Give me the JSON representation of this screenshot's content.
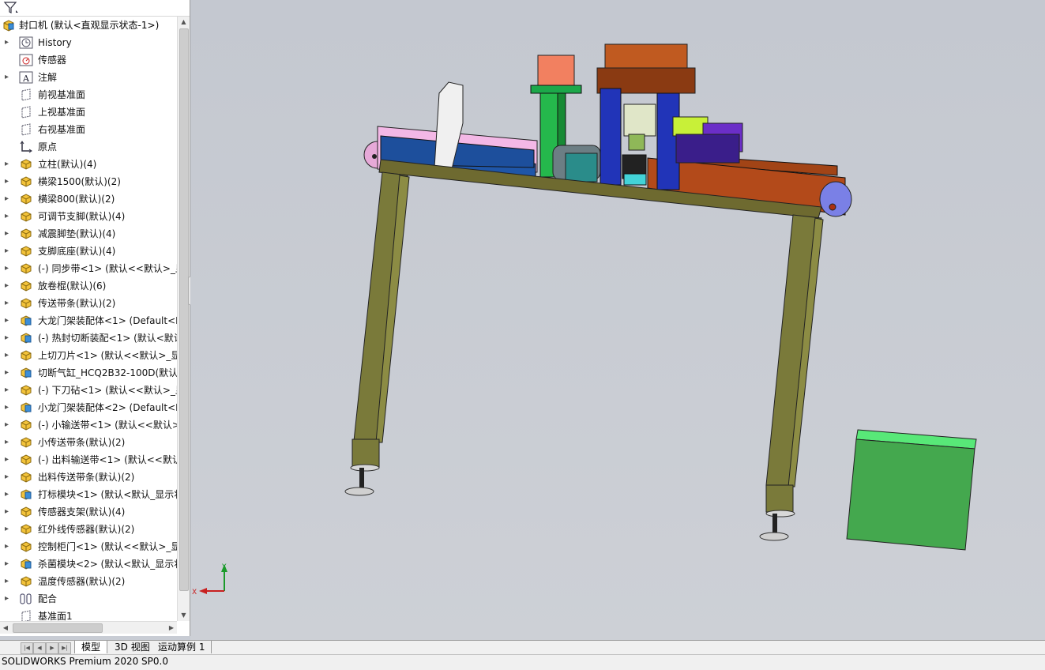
{
  "tree": {
    "root_label": "封口机  (默认<直观显示状态-1>)",
    "items": [
      {
        "label": "History",
        "icon": "history-icon",
        "expandable": true
      },
      {
        "label": "传感器",
        "icon": "sensor-icon",
        "expandable": false
      },
      {
        "label": "注解",
        "icon": "annotation-icon",
        "expandable": true
      },
      {
        "label": "前视基准面",
        "icon": "plane-icon",
        "expandable": false
      },
      {
        "label": "上视基准面",
        "icon": "plane-icon",
        "expandable": false
      },
      {
        "label": "右视基准面",
        "icon": "plane-icon",
        "expandable": false
      },
      {
        "label": "原点",
        "icon": "origin-icon",
        "expandable": false
      },
      {
        "label": "立柱(默认)(4)",
        "icon": "part-icon",
        "expandable": true
      },
      {
        "label": "横梁1500(默认)(2)",
        "icon": "part-icon",
        "expandable": true
      },
      {
        "label": "横梁800(默认)(2)",
        "icon": "part-icon",
        "expandable": true
      },
      {
        "label": "可调节支脚(默认)(4)",
        "icon": "part-icon",
        "expandable": true
      },
      {
        "label": "减震脚垫(默认)(4)",
        "icon": "part-icon",
        "expandable": true
      },
      {
        "label": "支脚底座(默认)(4)",
        "icon": "part-icon",
        "expandable": true
      },
      {
        "label": "(-) 同步带<1> (默认<<默认>_显",
        "icon": "part-icon",
        "expandable": true
      },
      {
        "label": "放卷棍(默认)(6)",
        "icon": "part-icon",
        "expandable": true
      },
      {
        "label": "传送带条(默认)(2)",
        "icon": "part-icon",
        "expandable": true
      },
      {
        "label": "大龙门架装配体<1> (Default<D",
        "icon": "assembly-icon",
        "expandable": true
      },
      {
        "label": "(-) 热封切断装配<1> (默认<默认",
        "icon": "assembly-icon",
        "expandable": true
      },
      {
        "label": "上切刀片<1> (默认<<默认>_显",
        "icon": "part-icon",
        "expandable": true
      },
      {
        "label": "切断气缸_HCQ2B32-100D(默认",
        "icon": "assembly-icon",
        "expandable": true
      },
      {
        "label": "(-) 下刀砧<1> (默认<<默认>_显",
        "icon": "part-icon",
        "expandable": true
      },
      {
        "label": "小龙门架装配体<2> (Default<D",
        "icon": "assembly-icon",
        "expandable": true
      },
      {
        "label": "(-) 小输送带<1> (默认<<默认>",
        "icon": "part-icon",
        "expandable": true
      },
      {
        "label": "小传送带条(默认)(2)",
        "icon": "part-icon",
        "expandable": true
      },
      {
        "label": "(-) 出料输送带<1> (默认<<默认",
        "icon": "part-icon",
        "expandable": true
      },
      {
        "label": "出料传送带条(默认)(2)",
        "icon": "part-icon",
        "expandable": true
      },
      {
        "label": "打标模块<1> (默认<默认_显示状",
        "icon": "assembly-icon",
        "expandable": true
      },
      {
        "label": "传感器支架(默认)(4)",
        "icon": "part-icon",
        "expandable": true
      },
      {
        "label": "红外线传感器(默认)(2)",
        "icon": "part-icon",
        "expandable": true
      },
      {
        "label": "控制柜门<1> (默认<<默认>_显",
        "icon": "part-icon",
        "expandable": true
      },
      {
        "label": "杀菌模块<2> (默认<默认_显示状",
        "icon": "assembly-icon",
        "expandable": true
      },
      {
        "label": "温度传感器(默认)(2)",
        "icon": "part-icon",
        "expandable": true
      },
      {
        "label": "配合",
        "icon": "mates-icon",
        "expandable": true
      },
      {
        "label": "基准面1",
        "icon": "plane-icon",
        "expandable": false
      }
    ]
  },
  "tabs": [
    "模型",
    "3D 视图",
    "运动算例 1"
  ],
  "active_tab": "模型",
  "status_bar": "SOLIDWORKS Premium 2020 SP0.0",
  "triad": {
    "x": "X",
    "y": "Y"
  },
  "colors": {
    "viewport": "#c6cad2",
    "frame": "#7a7a3a",
    "green_box": "#44a84e"
  }
}
